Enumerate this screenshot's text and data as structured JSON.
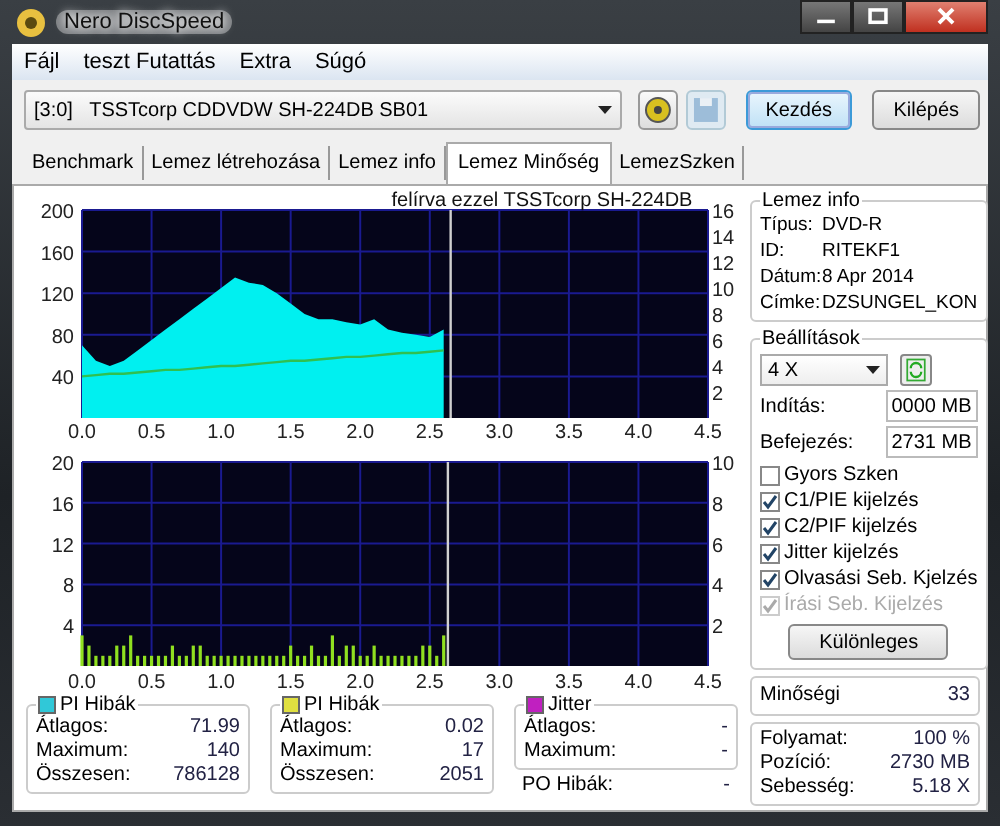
{
  "window": {
    "title": "Nero DiscSpeed"
  },
  "menu": [
    "Fájl",
    "teszt Futattás",
    "Extra",
    "Súgó"
  ],
  "toolbar": {
    "drive": "[3:0]   TSSTcorp CDDVDW SH-224DB SB01",
    "icon_buttons": [
      {
        "kind": "tool",
        "disabled": false
      },
      {
        "kind": "save",
        "disabled": true
      }
    ],
    "buttons": [
      {
        "label": "Kezdés",
        "default": true
      },
      {
        "label": "Kilépés",
        "default": false
      }
    ]
  },
  "tabs": [
    {
      "label": "Benchmark",
      "selected": false
    },
    {
      "label": "Lemez létrehozása",
      "selected": false
    },
    {
      "label": "Lemez info",
      "selected": false
    },
    {
      "label": "Lemez Minőség",
      "selected": true
    },
    {
      "label": "LemezSzken",
      "selected": false
    }
  ],
  "top_chart": {
    "chart_data": {
      "type": "area",
      "title": "felírva ezzel TSSTcorp SH-224DB",
      "xlim": [
        0,
        4.5
      ],
      "ylim": [
        0,
        200
      ],
      "y2lim": [
        0,
        16
      ],
      "xticks": [
        {
          "value": 0,
          "label": "0.0"
        },
        {
          "value": 0.5,
          "label": "0.5"
        },
        {
          "value": 1,
          "label": "1.0"
        },
        {
          "value": 1.5,
          "label": "1.5"
        },
        {
          "value": 2,
          "label": "2.0"
        },
        {
          "value": 2.5,
          "label": "2.5"
        },
        {
          "value": 3,
          "label": "3.0"
        },
        {
          "value": 3.5,
          "label": "3.5"
        },
        {
          "value": 4,
          "label": "4.0"
        },
        {
          "value": 4.5,
          "label": "4.5"
        }
      ],
      "yticks": [
        40,
        80,
        120,
        160,
        200
      ],
      "y2ticks": [
        2,
        4,
        6,
        8,
        10,
        12,
        14,
        16
      ],
      "x": [
        0,
        0.1,
        0.2,
        0.3,
        0.4,
        0.5,
        0.6,
        0.7,
        0.8,
        0.9,
        1,
        1.1,
        1.2,
        1.3,
        1.4,
        1.5,
        1.6,
        1.7,
        1.8,
        1.9,
        2,
        2.1,
        2.2,
        2.3,
        2.4,
        2.5,
        2.6
      ],
      "series": [
        {
          "color": "#00f0f0",
          "values": [
            70,
            55,
            50,
            55,
            65,
            75,
            85,
            95,
            105,
            115,
            125,
            135,
            130,
            128,
            120,
            110,
            100,
            95,
            95,
            92,
            90,
            95,
            85,
            82,
            80,
            78,
            85
          ]
        },
        {
          "type": "line",
          "axis": "y2",
          "color": "#30c050",
          "values": [
            3.2,
            3.3,
            3.4,
            3.4,
            3.5,
            3.6,
            3.7,
            3.7,
            3.8,
            3.9,
            4,
            4,
            4.1,
            4.2,
            4.3,
            4.4,
            4.4,
            4.5,
            4.6,
            4.7,
            4.7,
            4.8,
            4.9,
            5,
            5,
            5.1,
            5.2
          ]
        }
      ],
      "ref_lines": [
        {
          "axis": "x",
          "value": 2.65
        }
      ],
      "grid": true
    }
  },
  "bottom_chart": {
    "chart_data": {
      "type": "bar",
      "grid": true,
      "xlim": [
        0,
        4.5
      ],
      "ylim": [
        0,
        20
      ],
      "y2lim": [
        0,
        10
      ],
      "xticks": [
        {
          "value": 0,
          "label": "0.0"
        },
        {
          "value": 0.5,
          "label": "0.5"
        },
        {
          "value": 1,
          "label": "1.0"
        },
        {
          "value": 1.5,
          "label": "1.5"
        },
        {
          "value": 2,
          "label": "2.0"
        },
        {
          "value": 2.5,
          "label": "2.5"
        },
        {
          "value": 3,
          "label": "3.0"
        },
        {
          "value": 3.5,
          "label": "3.5"
        },
        {
          "value": 4,
          "label": "4.0"
        },
        {
          "value": 4.5,
          "label": "4.5"
        }
      ],
      "yticks": [
        4,
        8,
        12,
        16,
        20
      ],
      "y2ticks": [
        2,
        4,
        6,
        8,
        10
      ],
      "x": [
        0,
        0.05,
        0.1,
        0.15,
        0.2,
        0.25,
        0.3,
        0.35,
        0.4,
        0.45,
        0.5,
        0.55,
        0.6,
        0.65,
        0.7,
        0.75,
        0.8,
        0.85,
        0.9,
        0.95,
        1,
        1.05,
        1.1,
        1.15,
        1.2,
        1.25,
        1.3,
        1.35,
        1.4,
        1.45,
        1.5,
        1.55,
        1.6,
        1.65,
        1.7,
        1.75,
        1.8,
        1.85,
        1.9,
        1.95,
        2,
        2.05,
        2.1,
        2.15,
        2.2,
        2.25,
        2.3,
        2.35,
        2.4,
        2.45,
        2.5,
        2.55,
        2.6
      ],
      "series": [
        {
          "color": "#90e020",
          "values": [
            3,
            2,
            1,
            1,
            1,
            2,
            2,
            3,
            1,
            1,
            1,
            1,
            1,
            2,
            1,
            1,
            2,
            2,
            1,
            1,
            1,
            1,
            1,
            1,
            1,
            1,
            1,
            1,
            1,
            1,
            2,
            1,
            1,
            2,
            1,
            1,
            3,
            1,
            2,
            2,
            1,
            1,
            2,
            1,
            1,
            1,
            1,
            1,
            1,
            2,
            2,
            1,
            3
          ]
        }
      ]
    }
  },
  "stats": [
    {
      "title": "PI Hibák",
      "color": "#30c8d8",
      "rows": [
        {
          "label": "Átlagos:",
          "value": "71.99"
        },
        {
          "label": "Maximum:",
          "value": "140"
        },
        {
          "label": "Összesen:",
          "value": "786128"
        }
      ]
    },
    {
      "title": "PI Hibák",
      "color": "#e0e040",
      "rows": [
        {
          "label": "Átlagos:",
          "value": "0.02"
        },
        {
          "label": "Maximum:",
          "value": "17"
        },
        {
          "label": "Összesen:",
          "value": "2051"
        }
      ]
    },
    {
      "title": "Jitter",
      "color": "#c020c0",
      "rows": [
        {
          "label": "Átlagos:",
          "value": "-"
        },
        {
          "label": "Maximum:",
          "value": "-"
        }
      ]
    }
  ],
  "po": {
    "label": "PO Hibák:",
    "value": "-"
  },
  "disc_info": {
    "title": "Lemez info",
    "rows": [
      {
        "label": "Típus:",
        "value": "DVD-R"
      },
      {
        "label": "ID:",
        "value": "RITEKF1"
      },
      {
        "label": "Dátum:",
        "value": "8 Apr 2014"
      },
      {
        "label": "Címke:",
        "value": "DZSUNGEL_KON"
      }
    ]
  },
  "settings": {
    "title": "Beállítások",
    "speed": "4 X",
    "start": {
      "label": "Indítás:",
      "value": "0000 MB"
    },
    "end": {
      "label": "Befejezés:",
      "value": "2731 MB"
    },
    "options": [
      {
        "label": "Gyors Szken",
        "checked": false,
        "disabled": false
      },
      {
        "label": "C1/PIE kijelzés",
        "checked": true,
        "disabled": false
      },
      {
        "label": "C2/PIF kijelzés",
        "checked": true,
        "disabled": false
      },
      {
        "label": "Jitter kijelzés",
        "checked": true,
        "disabled": false
      },
      {
        "label": "Olvasási Seb. Kjelzés",
        "checked": true,
        "disabled": false
      },
      {
        "label": "Írási Seb. Kijelzés",
        "checked": true,
        "disabled": true
      }
    ],
    "button": "Különleges"
  },
  "quality": {
    "label": "Minőségi",
    "value": "33"
  },
  "progress": [
    {
      "label": "Folyamat:",
      "value": "100 %"
    },
    {
      "label": "Pozíció:",
      "value": "2730 MB"
    },
    {
      "label": "Sebesség:",
      "value": "5.18 X"
    }
  ]
}
